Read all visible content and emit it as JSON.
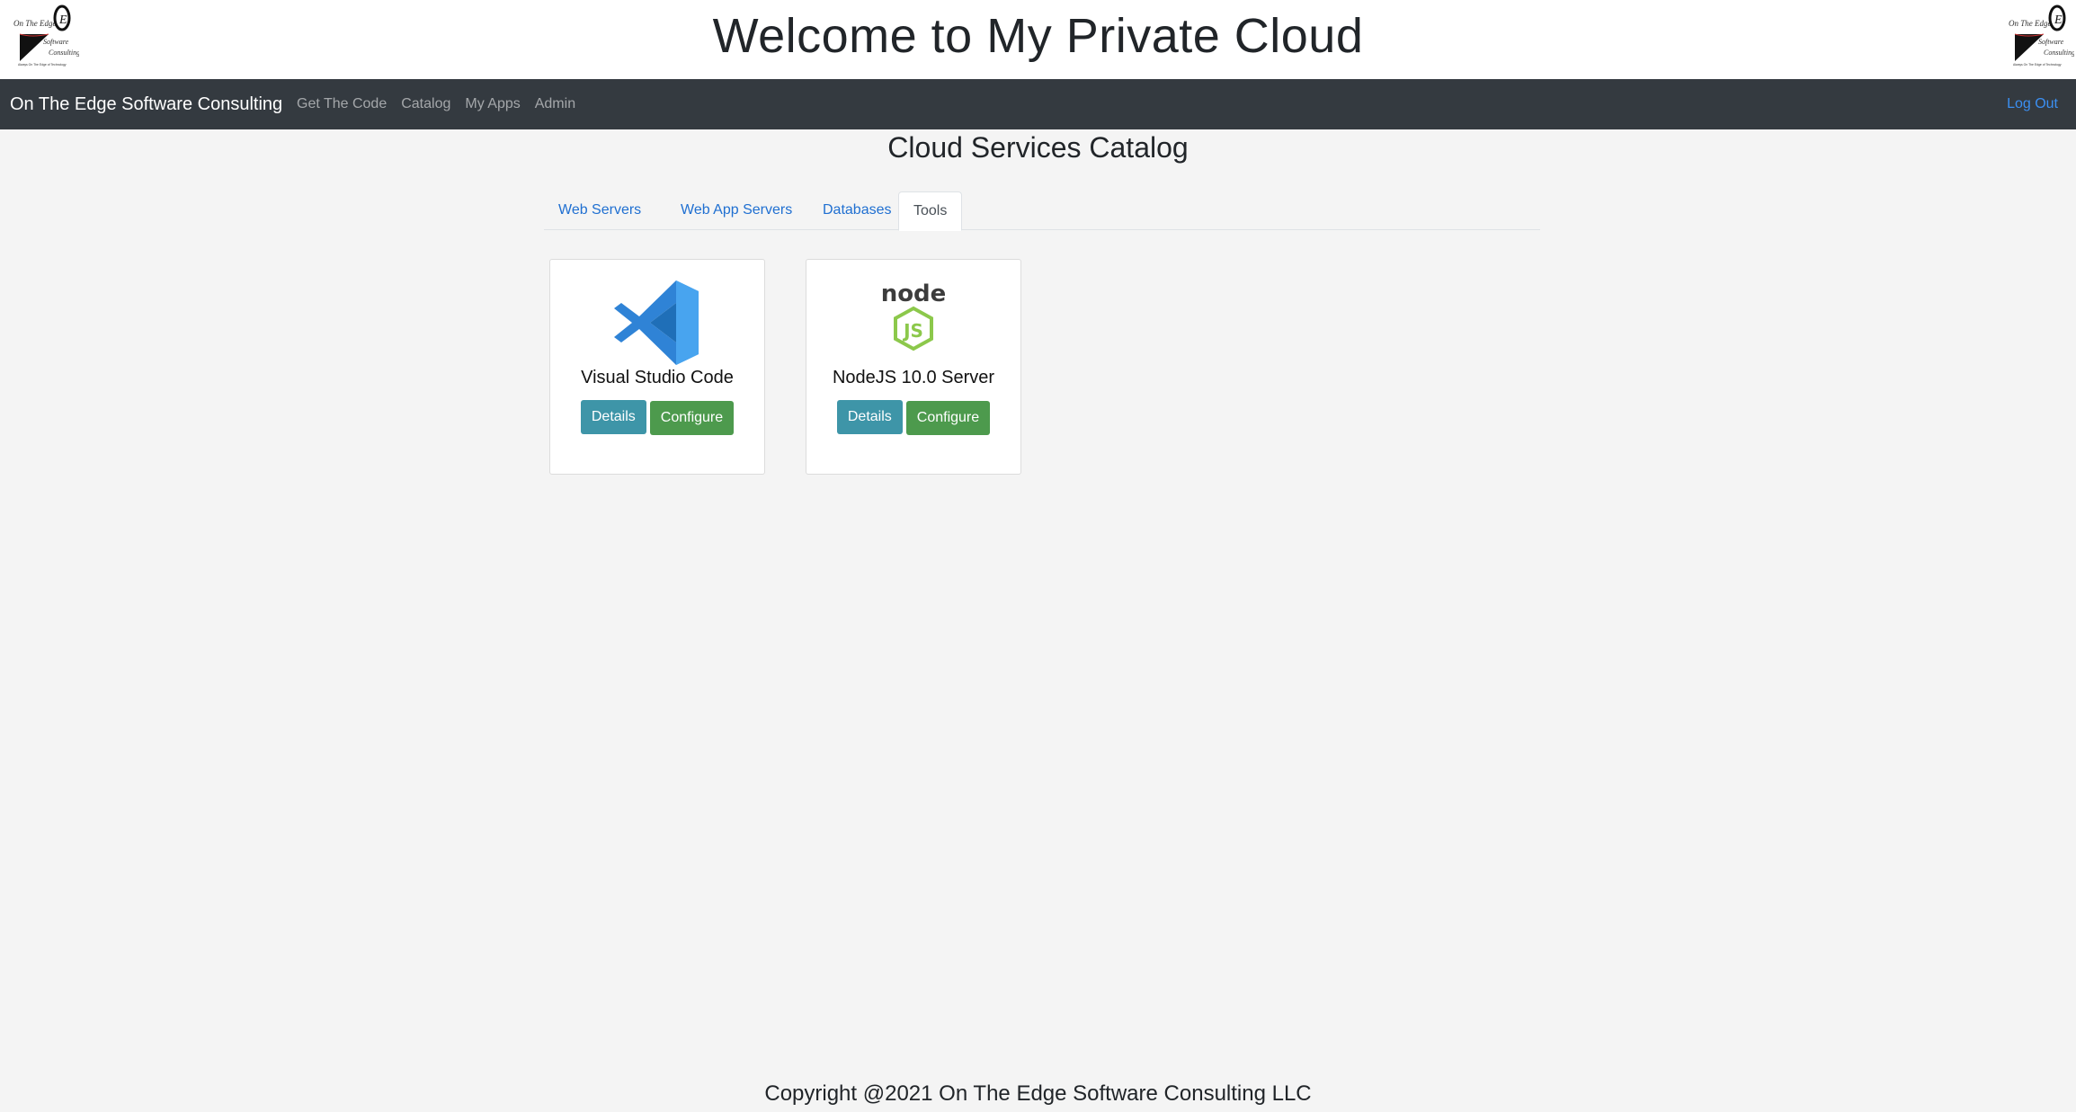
{
  "header": {
    "title": "Welcome to My Private Cloud",
    "logo": {
      "line1": "On The Edge",
      "line2": "Software",
      "line3": "Consulting",
      "tagline": "Always On The Edge of Technology"
    }
  },
  "navbar": {
    "brand": "On The Edge Software Consulting",
    "links": [
      "Get The Code",
      "Catalog",
      "My Apps",
      "Admin"
    ],
    "logout": "Log Out"
  },
  "catalog": {
    "title": "Cloud Services Catalog",
    "tabs": [
      {
        "label": "Web Servers",
        "active": false
      },
      {
        "label": "Web App Servers",
        "active": false
      },
      {
        "label": "Databases",
        "active": false
      },
      {
        "label": "Tools",
        "active": true
      }
    ],
    "cards": [
      {
        "title": "Visual Studio Code",
        "icon": "vscode-icon",
        "details_label": "Details",
        "configure_label": "Configure"
      },
      {
        "title": "NodeJS 10.0 Server",
        "icon": "nodejs-icon",
        "icon_text": "node",
        "icon_text_js": "JS",
        "details_label": "Details",
        "configure_label": "Configure"
      }
    ]
  },
  "footer": {
    "copyright": "Copyright @2021 On The Edge Software Consulting LLC"
  },
  "colors": {
    "navbar": "#343a40",
    "link": "#1f6fd1",
    "logout": "#3b8ff2",
    "details_button": "#3e95a8",
    "configure_button": "#4d9a4d",
    "node_green": "#8cc84b",
    "vscode_blue": "#2f83d6"
  }
}
